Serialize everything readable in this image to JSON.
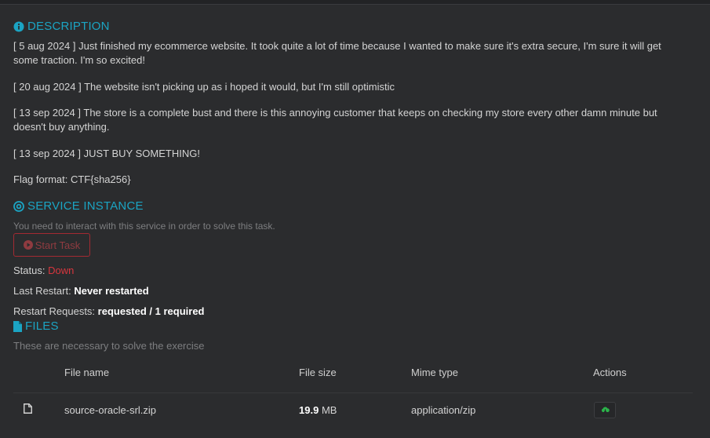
{
  "description": {
    "title": "DESCRIPTION",
    "paragraphs": [
      "[ 5 aug 2024 ] Just finished my ecommerce website. It took quite a lot of time because I wanted to make sure it's extra secure, I'm sure it will get some traction. I'm so excited!",
      "[ 20 aug 2024 ] The website isn't picking up as i hoped it would, but I'm still optimistic",
      "[ 13 sep 2024 ] The store is a complete bust and there is this annoying customer that keeps on checking my store every other damn minute but doesn't buy anything.",
      "[ 13 sep 2024 ] JUST BUY SOMETHING!",
      "Flag format: CTF{sha256}"
    ]
  },
  "service": {
    "title": "SERVICE INSTANCE",
    "hint": "You need to interact with this service in order to solve this task.",
    "start_label": "Start Task",
    "status_label": "Status:",
    "status_value": "Down",
    "last_restart_label": "Last Restart:",
    "last_restart_value": "Never restarted",
    "restart_requests_label": "Restart Requests:",
    "restart_requests_value": "requested / 1 required"
  },
  "files": {
    "title": "FILES",
    "hint": "These are necessary to solve the exercise",
    "columns": [
      "File name",
      "File size",
      "Mime type",
      "Actions"
    ],
    "rows": [
      {
        "name": "source-oracle-srl.zip",
        "size_value": "19.9",
        "size_unit": "MB",
        "mime": "application/zip"
      }
    ]
  },
  "colors": {
    "accent": "#1ba4c3",
    "danger": "#d9363e",
    "background": "#2b2c2e"
  }
}
